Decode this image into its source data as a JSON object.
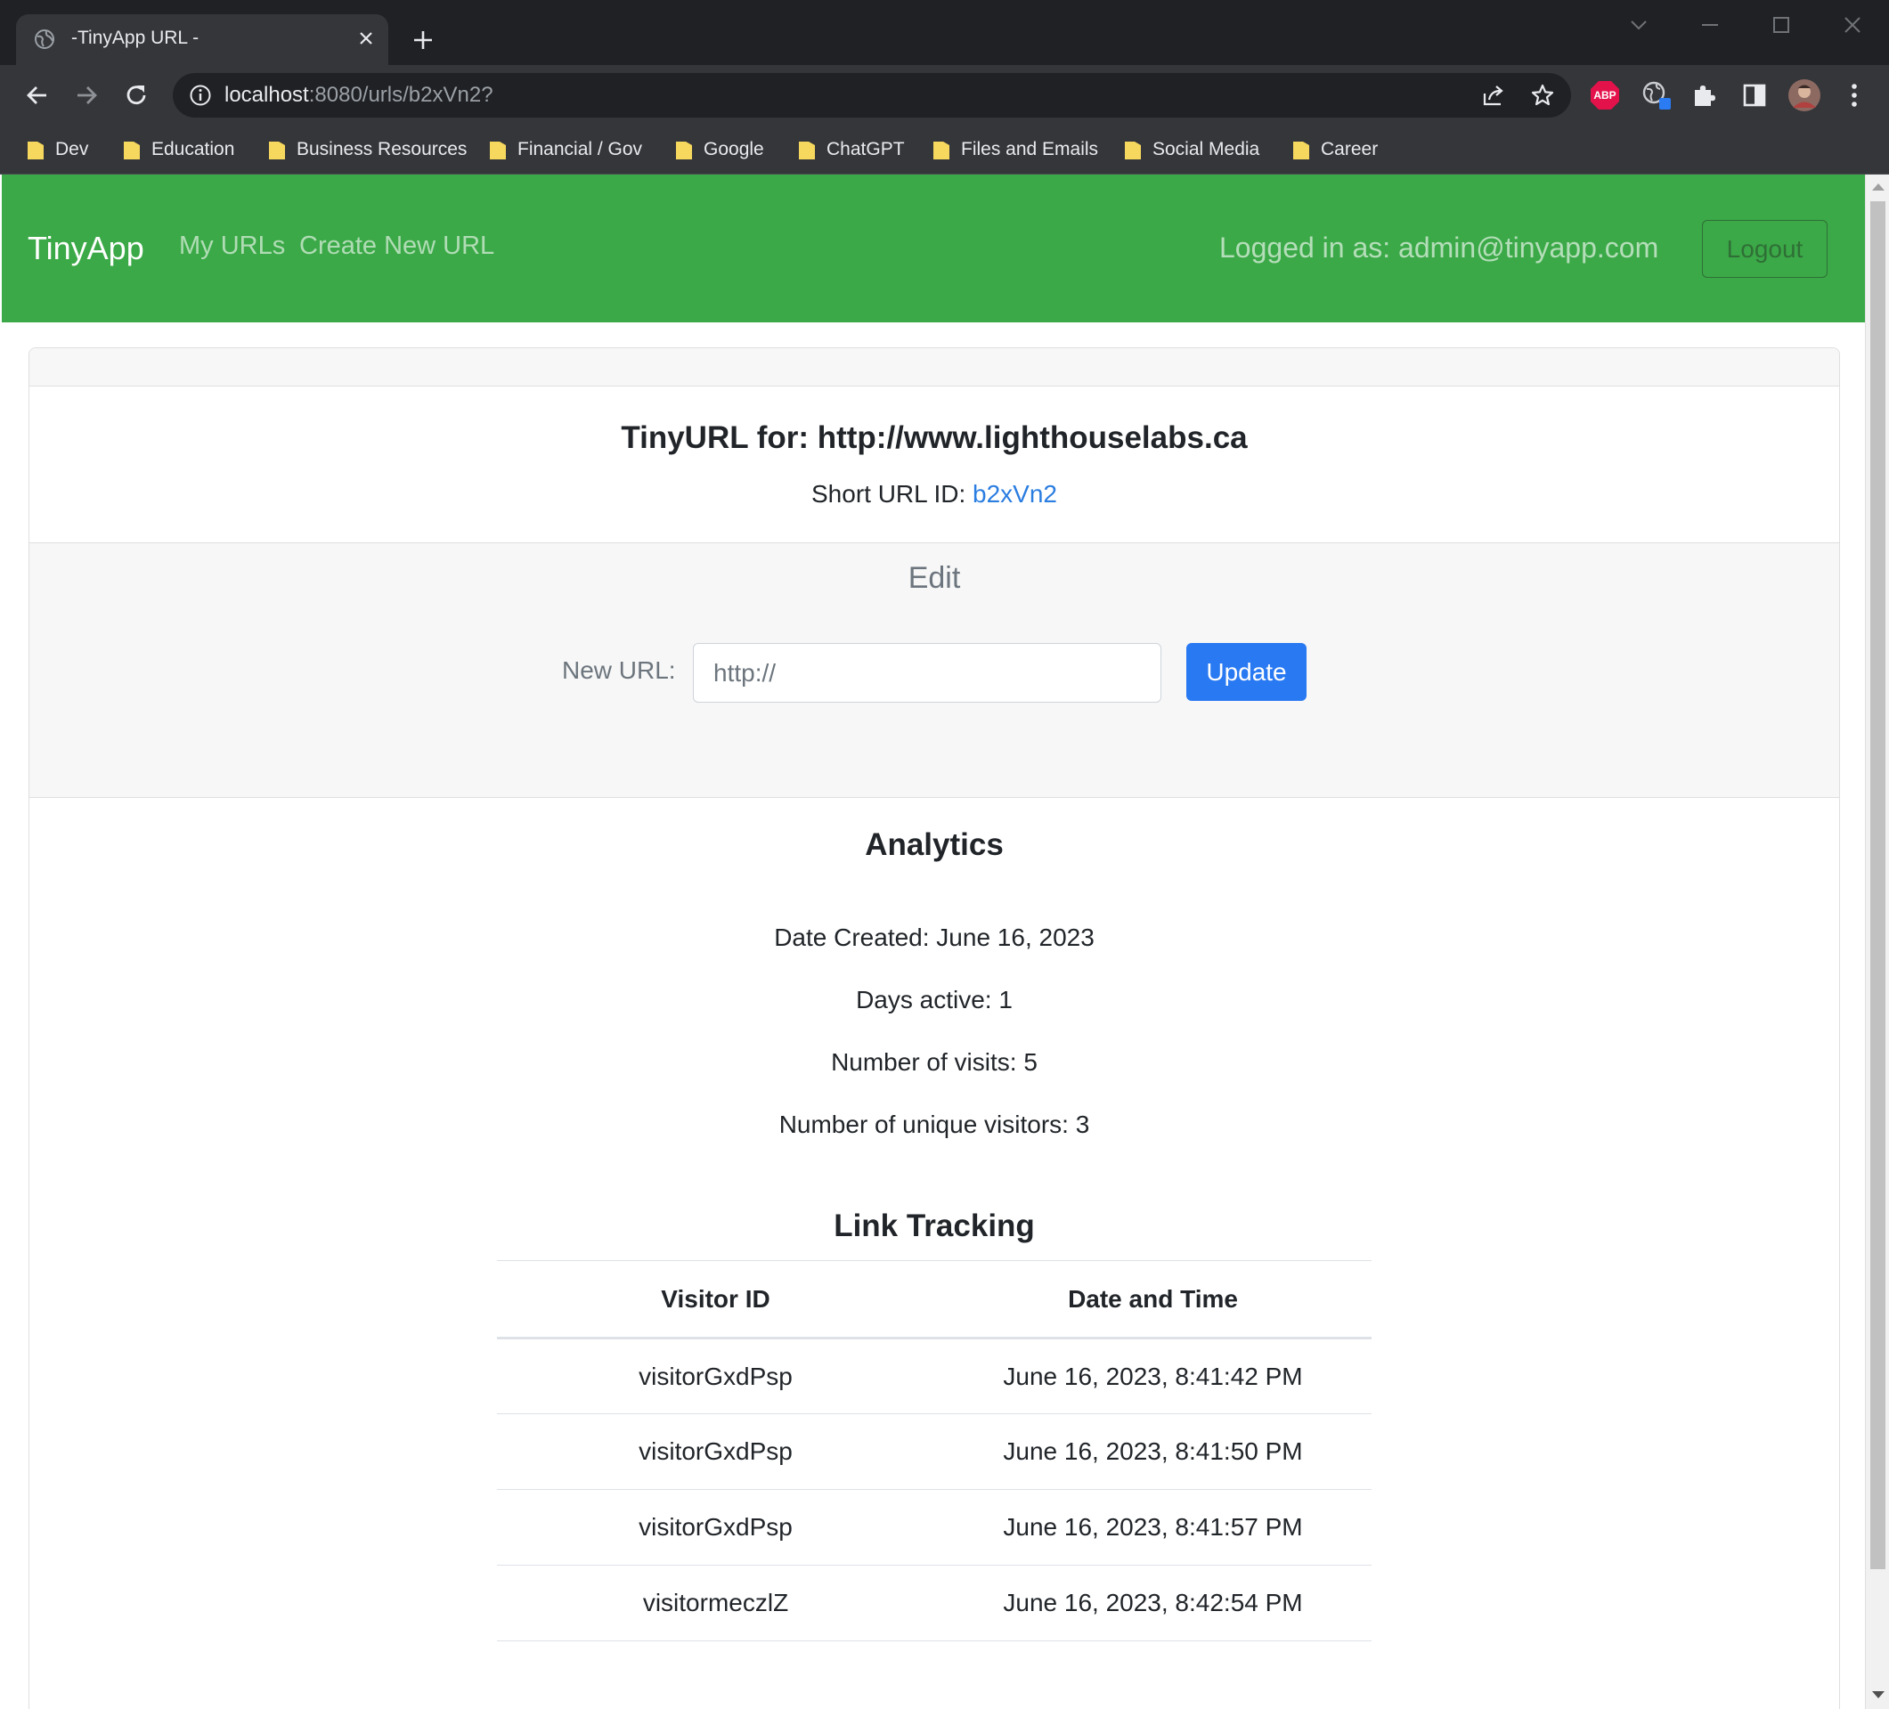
{
  "browser": {
    "tab_title": "-TinyApp URL -",
    "url_host": "localhost",
    "url_path": ":8080/urls/b2xVn2?",
    "extension_abp": "ABP",
    "bookmarks": [
      "Dev",
      "Education",
      "Business Resources",
      "Financial / Gov",
      "Google",
      "ChatGPT",
      "Files and Emails",
      "Social Media",
      "Career"
    ]
  },
  "navbar": {
    "brand": "TinyApp",
    "links": [
      "My URLs",
      "Create New URL"
    ],
    "logged_in_text": "Logged in as: admin@tinyapp.com",
    "logout_label": "Logout",
    "color": "#3ba947"
  },
  "card": {
    "title": "TinyURL for: http://www.lighthouselabs.ca",
    "short_id_label": "Short URL ID:",
    "short_id": "b2xVn2"
  },
  "edit": {
    "title": "Edit",
    "label": "New URL:",
    "input_placeholder": "http://",
    "input_value": "",
    "update_label": "Update"
  },
  "analytics": {
    "title": "Analytics",
    "stats": [
      "Date Created: June 16, 2023",
      "Days active: 1",
      "Number of visits: 5",
      "Number of unique visitors: 3"
    ]
  },
  "tracking": {
    "title": "Link Tracking",
    "columns": [
      "Visitor ID",
      "Date and Time"
    ],
    "rows": [
      [
        "visitorGxdPsp",
        "June 16, 2023, 8:41:42 PM"
      ],
      [
        "visitorGxdPsp",
        "June 16, 2023, 8:41:50 PM"
      ],
      [
        "visitorGxdPsp",
        "June 16, 2023, 8:41:57 PM"
      ],
      [
        "visitormeczlZ",
        "June 16, 2023, 8:42:54 PM"
      ]
    ]
  },
  "icons": {
    "tab": "globe-icon",
    "close": "close-icon",
    "new_tab": "plus-icon",
    "back": "back-arrow-icon",
    "forward": "forward-arrow-icon",
    "reload": "reload-icon",
    "info": "info-icon",
    "share": "share-icon",
    "star": "star-icon",
    "extensions": "puzzle-icon",
    "side_panel": "side-panel-icon",
    "menu": "kebab-menu-icon",
    "folder": "folder-icon"
  }
}
